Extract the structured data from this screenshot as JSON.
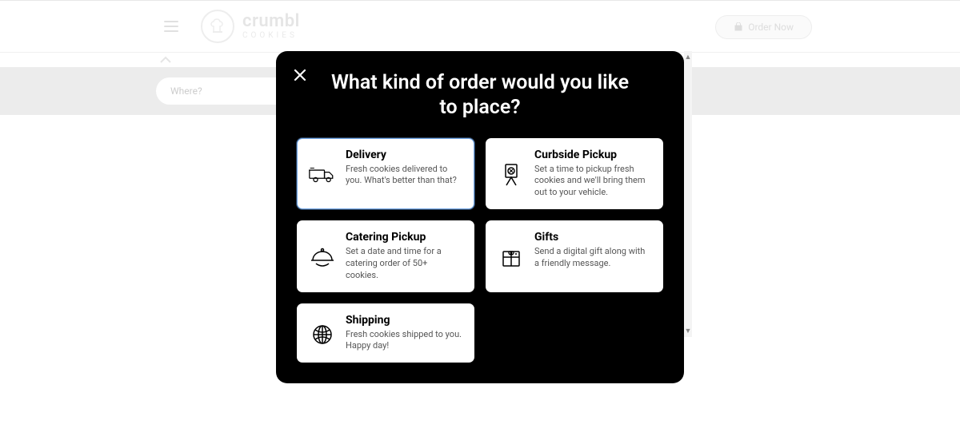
{
  "brand": {
    "name": "crumbl",
    "sub": "cookies"
  },
  "header": {
    "order_label": "Order Now"
  },
  "search": {
    "placeholder": "Where?"
  },
  "modal": {
    "title": "What kind of order would you like to place?",
    "options": [
      {
        "id": "delivery",
        "title": "Delivery",
        "desc": "Fresh cookies delivered to you. What's better than that?",
        "selected": true
      },
      {
        "id": "curbside",
        "title": "Curbside Pickup",
        "desc": "Set a time to pickup fresh cookies and we'll bring them out to your vehicle."
      },
      {
        "id": "catering",
        "title": "Catering Pickup",
        "desc": "Set a date and time for a catering order of 50+ cookies."
      },
      {
        "id": "gifts",
        "title": "Gifts",
        "desc": "Send a digital gift along with a friendly message."
      },
      {
        "id": "shipping",
        "title": "Shipping",
        "desc": "Fresh cookies shipped to you. Happy day!"
      }
    ]
  }
}
